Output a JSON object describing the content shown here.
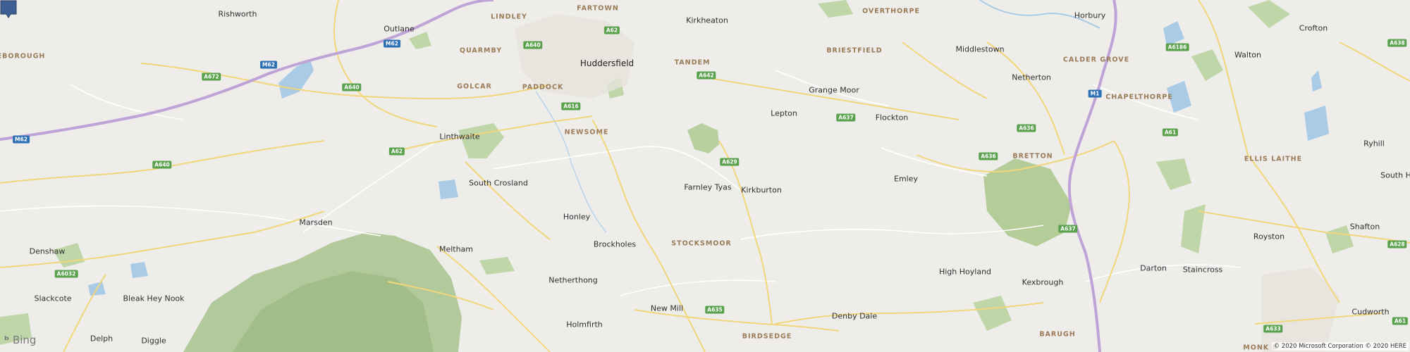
{
  "map": {
    "places": [
      {
        "name": "Rishworth",
        "kind": "village"
      },
      {
        "name": "Outlane",
        "kind": "village"
      },
      {
        "name": "LINDLEY",
        "kind": "district"
      },
      {
        "name": "FARTOWN",
        "kind": "district"
      },
      {
        "name": "Kirkheaton",
        "kind": "village"
      },
      {
        "name": "OVERTHORPE",
        "kind": "district"
      },
      {
        "name": "Horbury",
        "kind": "village"
      },
      {
        "name": "Crofton",
        "kind": "village"
      },
      {
        "name": "EBOROUGH",
        "kind": "district"
      },
      {
        "name": "QUARMBY",
        "kind": "district"
      },
      {
        "name": "BRIESTFIELD",
        "kind": "district"
      },
      {
        "name": "Middlestown",
        "kind": "village"
      },
      {
        "name": "Walton",
        "kind": "village"
      },
      {
        "name": "Huddersfield",
        "kind": "town"
      },
      {
        "name": "TANDEM",
        "kind": "district"
      },
      {
        "name": "CALDER GROVE",
        "kind": "district"
      },
      {
        "name": "Netherton",
        "kind": "village"
      },
      {
        "name": "GOLCAR",
        "kind": "district"
      },
      {
        "name": "PADDOCK",
        "kind": "district"
      },
      {
        "name": "Grange Moor",
        "kind": "village"
      },
      {
        "name": "CHAPELTHORPE",
        "kind": "district"
      },
      {
        "name": "Lepton",
        "kind": "village"
      },
      {
        "name": "Flockton",
        "kind": "village"
      },
      {
        "name": "NEWSOME",
        "kind": "district"
      },
      {
        "name": "Linthwaite",
        "kind": "village"
      },
      {
        "name": "Ryhill",
        "kind": "village"
      },
      {
        "name": "BRETTON",
        "kind": "district"
      },
      {
        "name": "ELLIS LAITHE",
        "kind": "district"
      },
      {
        "name": "South Crosland",
        "kind": "village"
      },
      {
        "name": "Farnley Tyas",
        "kind": "village"
      },
      {
        "name": "Kirkburton",
        "kind": "village"
      },
      {
        "name": "Emley",
        "kind": "village"
      },
      {
        "name": "South H",
        "kind": "village"
      },
      {
        "name": "Honley",
        "kind": "village"
      },
      {
        "name": "Marsden",
        "kind": "village"
      },
      {
        "name": "Shafton",
        "kind": "village"
      },
      {
        "name": "Denshaw",
        "kind": "village"
      },
      {
        "name": "Brockholes",
        "kind": "village"
      },
      {
        "name": "STOCKSMOOR",
        "kind": "district"
      },
      {
        "name": "Meltham",
        "kind": "village"
      },
      {
        "name": "Royston",
        "kind": "village"
      },
      {
        "name": "Darton",
        "kind": "village"
      },
      {
        "name": "Staincross",
        "kind": "village"
      },
      {
        "name": "High Hoyland",
        "kind": "village"
      },
      {
        "name": "Slackcote",
        "kind": "village"
      },
      {
        "name": "Bleak Hey Nook",
        "kind": "village"
      },
      {
        "name": "Netherthong",
        "kind": "village"
      },
      {
        "name": "Kexbrough",
        "kind": "village"
      },
      {
        "name": "New Mill",
        "kind": "village"
      },
      {
        "name": "Denby Dale",
        "kind": "village"
      },
      {
        "name": "Cudworth",
        "kind": "village"
      },
      {
        "name": "Holmfirth",
        "kind": "village"
      },
      {
        "name": "Delph",
        "kind": "village"
      },
      {
        "name": "Diggle",
        "kind": "village"
      },
      {
        "name": "BIRDSEDGE",
        "kind": "district"
      },
      {
        "name": "BARUGH",
        "kind": "district"
      },
      {
        "name": "MONK B",
        "kind": "district"
      }
    ],
    "road_shields": [
      {
        "label": "M62",
        "kind": "motorway"
      },
      {
        "label": "M62",
        "kind": "motorway"
      },
      {
        "label": "M62",
        "kind": "motorway"
      },
      {
        "label": "M1",
        "kind": "motorway"
      },
      {
        "label": "A640",
        "kind": "a-road"
      },
      {
        "label": "A62",
        "kind": "a-road"
      },
      {
        "label": "A672",
        "kind": "a-road"
      },
      {
        "label": "A640",
        "kind": "a-road"
      },
      {
        "label": "A642",
        "kind": "a-road"
      },
      {
        "label": "A616",
        "kind": "a-road"
      },
      {
        "label": "A637",
        "kind": "a-road"
      },
      {
        "label": "A636",
        "kind": "a-road"
      },
      {
        "label": "A61",
        "kind": "a-road"
      },
      {
        "label": "A6186",
        "kind": "a-road"
      },
      {
        "label": "A638",
        "kind": "a-road"
      },
      {
        "label": "A629",
        "kind": "a-road"
      },
      {
        "label": "A62",
        "kind": "a-road"
      },
      {
        "label": "A640",
        "kind": "a-road"
      },
      {
        "label": "A636",
        "kind": "a-road"
      },
      {
        "label": "A6032",
        "kind": "a-road"
      },
      {
        "label": "A637",
        "kind": "a-road"
      },
      {
        "label": "A628",
        "kind": "a-road"
      },
      {
        "label": "A635",
        "kind": "a-road"
      },
      {
        "label": "A633",
        "kind": "a-road"
      },
      {
        "label": "A61",
        "kind": "a-road"
      }
    ],
    "pin_color": "#3d5f91"
  },
  "footer": {
    "logo_text": "Bing",
    "copyright": "© 2020 Microsoft Corporation © 2020 HERE"
  }
}
